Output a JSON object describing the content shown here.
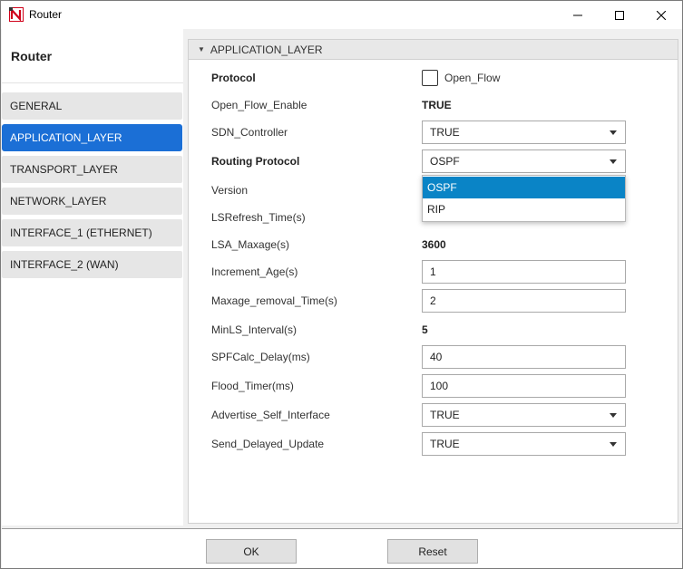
{
  "window": {
    "title": "Router"
  },
  "sidebar": {
    "title": "Router",
    "items": [
      {
        "label": "GENERAL",
        "active": false
      },
      {
        "label": "APPLICATION_LAYER",
        "active": true
      },
      {
        "label": "TRANSPORT_LAYER",
        "active": false
      },
      {
        "label": "NETWORK_LAYER",
        "active": false
      },
      {
        "label": "INTERFACE_1 (ETHERNET)",
        "active": false
      },
      {
        "label": "INTERFACE_2 (WAN)",
        "active": false
      }
    ]
  },
  "section": {
    "title": "APPLICATION_LAYER"
  },
  "properties": {
    "protocol": {
      "label": "Protocol",
      "checkbox_label": "Open_Flow",
      "checked": false
    },
    "open_flow_enable": {
      "label": "Open_Flow_Enable",
      "value": "TRUE"
    },
    "sdn_controller": {
      "label": "SDN_Controller",
      "value": "TRUE"
    },
    "routing_protocol": {
      "label": "Routing Protocol",
      "value": "OSPF"
    },
    "version": {
      "label": "Version"
    },
    "lsrefresh_time": {
      "label": "LSRefresh_Time(s)"
    },
    "lsa_maxage": {
      "label": "LSA_Maxage(s)",
      "value": "3600"
    },
    "increment_age": {
      "label": "Increment_Age(s)",
      "value": "1"
    },
    "maxage_removal_time": {
      "label": "Maxage_removal_Time(s)",
      "value": "2"
    },
    "minls_interval": {
      "label": "MinLS_Interval(s)",
      "value": "5"
    },
    "spfcalc_delay": {
      "label": "SPFCalc_Delay(ms)",
      "value": "40"
    },
    "flood_timer": {
      "label": "Flood_Timer(ms)",
      "value": "100"
    },
    "advertise_self_interface": {
      "label": "Advertise_Self_Interface",
      "value": "TRUE"
    },
    "send_delayed_update": {
      "label": "Send_Delayed_Update",
      "value": "TRUE"
    }
  },
  "routing_dropdown": {
    "options": [
      "OSPF",
      "RIP"
    ],
    "selected": "OSPF"
  },
  "buttons": {
    "ok": "OK",
    "reset": "Reset"
  },
  "colors": {
    "accent": "#1b6fd6",
    "dropdown_selected": "#0a84c6",
    "logo_red": "#d0021b"
  }
}
